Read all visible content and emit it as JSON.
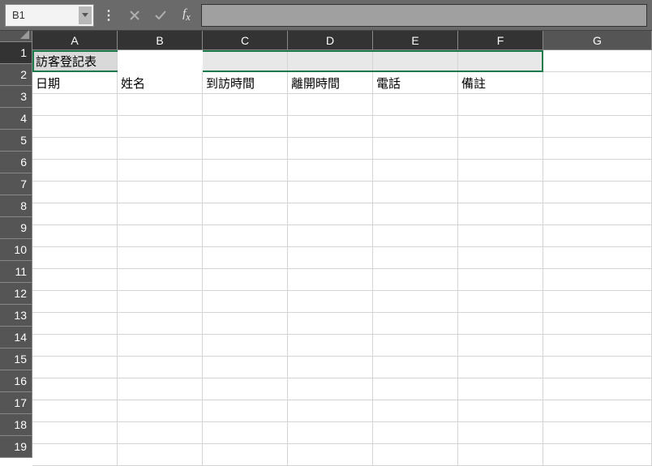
{
  "formula_bar": {
    "name_box_value": "B1",
    "formula_value": ""
  },
  "columns": [
    "A",
    "B",
    "C",
    "D",
    "E",
    "F",
    "G"
  ],
  "selected_columns": [
    "A",
    "B",
    "C",
    "D",
    "E",
    "F"
  ],
  "rows": [
    1,
    2,
    3,
    4,
    5,
    6,
    7,
    8,
    9,
    10,
    11,
    12,
    13,
    14,
    15,
    16,
    17,
    18,
    19
  ],
  "selected_rows": [
    1
  ],
  "cells": {
    "A1": "訪客登記表",
    "A2": "日期",
    "B2": "姓名",
    "C2": "到訪時間",
    "D2": "離開時間",
    "E2": "電話",
    "F2": "備註"
  }
}
